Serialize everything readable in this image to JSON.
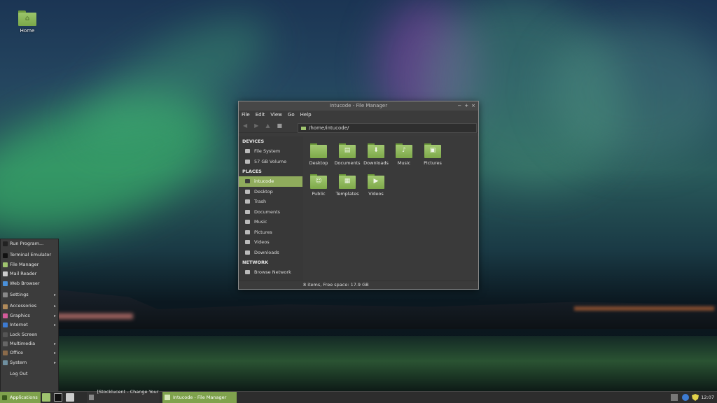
{
  "desktop": {
    "icons": [
      {
        "label": "Home",
        "icon": "home-folder-icon"
      }
    ]
  },
  "window": {
    "title": "Intucode - File Manager",
    "controls": [
      "−",
      "+",
      "×"
    ],
    "menu": [
      "File",
      "Edit",
      "View",
      "Go",
      "Help"
    ],
    "location": "/home/intucode/",
    "sidebar": {
      "sections": [
        {
          "title": "DEVICES",
          "items": [
            {
              "label": "File System",
              "icon": "harddisk-icon"
            },
            {
              "label": "57 GB Volume",
              "icon": "drive-icon"
            }
          ]
        },
        {
          "title": "PLACES",
          "items": [
            {
              "label": "intucode",
              "icon": "home-icon",
              "active": true
            },
            {
              "label": "Desktop",
              "icon": "desktop-icon"
            },
            {
              "label": "Trash",
              "icon": "trash-icon"
            },
            {
              "label": "Documents",
              "icon": "documents-icon"
            },
            {
              "label": "Music",
              "icon": "music-icon"
            },
            {
              "label": "Pictures",
              "icon": "pictures-icon"
            },
            {
              "label": "Videos",
              "icon": "videos-icon"
            },
            {
              "label": "Downloads",
              "icon": "downloads-icon"
            }
          ]
        },
        {
          "title": "NETWORK",
          "items": [
            {
              "label": "Browse Network",
              "icon": "network-icon"
            }
          ]
        }
      ]
    },
    "files": [
      {
        "label": "Desktop",
        "icon": "desktop-folder-icon",
        "glyph": ""
      },
      {
        "label": "Documents",
        "icon": "documents-folder-icon",
        "glyph": "▤"
      },
      {
        "label": "Downloads",
        "icon": "downloads-folder-icon",
        "glyph": "⬇"
      },
      {
        "label": "Music",
        "icon": "music-folder-icon",
        "glyph": "♪"
      },
      {
        "label": "Pictures",
        "icon": "pictures-folder-icon",
        "glyph": "▣"
      },
      {
        "label": "Public",
        "icon": "public-folder-icon",
        "glyph": "☺"
      },
      {
        "label": "Templates",
        "icon": "templates-folder-icon",
        "glyph": "▦"
      },
      {
        "label": "Videos",
        "icon": "videos-folder-icon",
        "glyph": "▶"
      }
    ],
    "status": "8 items, Free space: 17.9 GB"
  },
  "app_menu": {
    "items": [
      {
        "label": "Run Program...",
        "icon": "run-icon",
        "color": "#222222",
        "submenu": false,
        "sep_after": true
      },
      {
        "label": "Terminal Emulator",
        "icon": "terminal-icon",
        "color": "#111111",
        "submenu": false
      },
      {
        "label": "File Manager",
        "icon": "file-manager-icon",
        "color": "#9fc46f",
        "submenu": false
      },
      {
        "label": "Mail Reader",
        "icon": "mail-icon",
        "color": "#cccccc",
        "submenu": false
      },
      {
        "label": "Web Browser",
        "icon": "web-browser-icon",
        "color": "#4a90d9",
        "submenu": false,
        "sep_after": true
      },
      {
        "label": "Settings",
        "icon": "settings-icon",
        "color": "#888888",
        "submenu": true,
        "sep_after": true
      },
      {
        "label": "Accessories",
        "icon": "accessories-icon",
        "color": "#b08a5a",
        "submenu": true
      },
      {
        "label": "Graphics",
        "icon": "graphics-icon",
        "color": "#d35b9a",
        "submenu": true
      },
      {
        "label": "Internet",
        "icon": "internet-icon",
        "color": "#3d7bd1",
        "submenu": true
      },
      {
        "label": "Lock Screen",
        "icon": "lock-icon",
        "color": "#555555",
        "submenu": false
      },
      {
        "label": "Multimedia",
        "icon": "multimedia-icon",
        "color": "#666666",
        "submenu": true
      },
      {
        "label": "Office",
        "icon": "office-icon",
        "color": "#8a6a4a",
        "submenu": true
      },
      {
        "label": "System",
        "icon": "system-icon",
        "color": "#6f8f9f",
        "submenu": true,
        "sep_after": true
      },
      {
        "label": "Log Out",
        "icon": "logout-icon",
        "color": "#3c3c3c",
        "submenu": false
      }
    ]
  },
  "taskbar": {
    "applications_label": "Applications",
    "launchers": [
      {
        "icon": "file-manager-launcher-icon",
        "color": "#9fc46f"
      },
      {
        "icon": "terminal-launcher-icon",
        "color": "#111111"
      },
      {
        "icon": "settings-launcher-icon",
        "color": "#cccccc"
      }
    ],
    "tasks": [
      {
        "label": "[Stocklucent - Change Your ...",
        "icon": "browser-task-icon",
        "active": false
      },
      {
        "label": "Intucode - File Manager",
        "icon": "file-manager-task-icon",
        "active": true
      }
    ],
    "tray": [
      "network-tray-icon",
      "bluetooth-tray-icon",
      "security-tray-icon"
    ],
    "clock": "12:07"
  }
}
